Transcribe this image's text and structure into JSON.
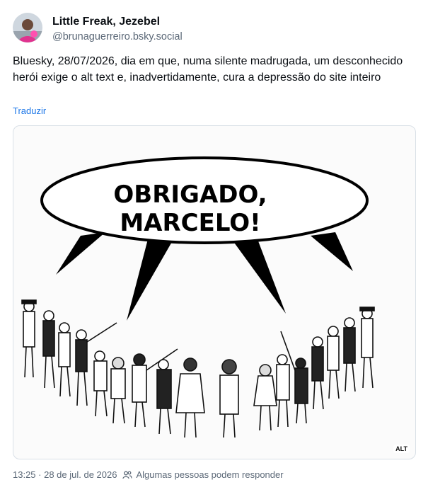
{
  "author": {
    "display_name": "Little Freak, Jezebel",
    "handle": "@brunaguerreiro.bsky.social",
    "avatar_icon": "profile-photo"
  },
  "post": {
    "text": "Bluesky, 28/07/2026, dia em que, numa silente madrugada, um desconhecido herói exige o alt text e, inadvertidamente, cura a depressão do site inteiro",
    "translate_label": "Traduzir"
  },
  "image": {
    "speech_line1": "OBRIGADO,",
    "speech_line2": "MARCELO!",
    "alt_label": "ALT"
  },
  "footer": {
    "timestamp": "13:25 · 28 de jul. de 2026",
    "reply_setting": "Algumas pessoas podem responder"
  },
  "colors": {
    "link": "#1e78e8",
    "muted": "#5b6877",
    "border": "#d9e0e7"
  }
}
